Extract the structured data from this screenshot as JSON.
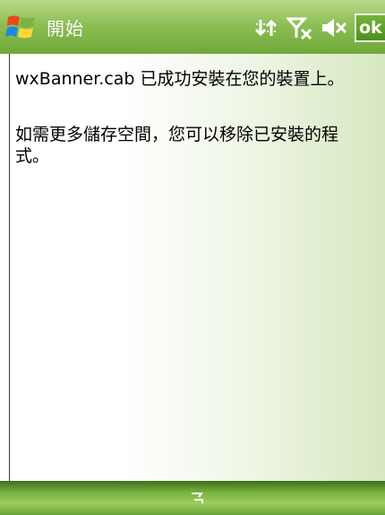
{
  "titlebar": {
    "title": "開始",
    "start_icon": "windows-flag-icon",
    "icons": [
      "connectivity-icon",
      "signal-off-icon",
      "speaker-muted-icon"
    ],
    "ok_label": "ok"
  },
  "dialog": {
    "message_line1": "wxBanner.cab 已成功安裝在您的裝置上。",
    "message_line2": "如需更多儲存空間，您可以移除已安裝的程式。"
  },
  "menubar": {
    "center_icon": "input-panel-icon"
  },
  "colors": {
    "title_bar": "#8dbf55",
    "ok_button": "#4e8f1c",
    "menu_bar": "#7cb342",
    "content_gradient_end": "#d6e8c0"
  }
}
